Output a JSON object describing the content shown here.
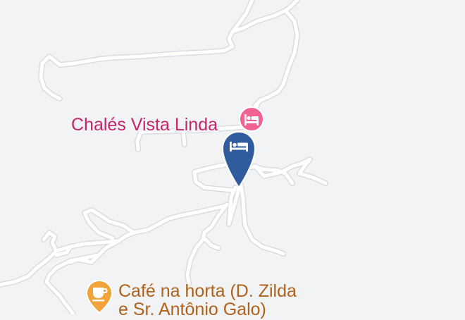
{
  "map": {
    "colors": {
      "background": "#f1f3f4",
      "road_fill": "#ffffff",
      "road_casing": "#dadce0",
      "hotel_poi": "#f06292",
      "hotel_label": "#c5266b",
      "selected_marker": "#2e5c9e",
      "cafe_poi": "#f2a33a",
      "cafe_label": "#b0621a"
    },
    "pois": [
      {
        "id": "hotel",
        "label": "Chalés Vista Linda",
        "icon": "bed-icon",
        "category": "lodging"
      },
      {
        "id": "cafe",
        "label_line1": "Café na horta (D. Zilda",
        "label_line2": "e Sr. Antônio Galo)",
        "icon": "coffee-cup-icon",
        "category": "cafe"
      }
    ],
    "selected_marker": {
      "icon": "bed-icon",
      "category": "lodging"
    }
  }
}
